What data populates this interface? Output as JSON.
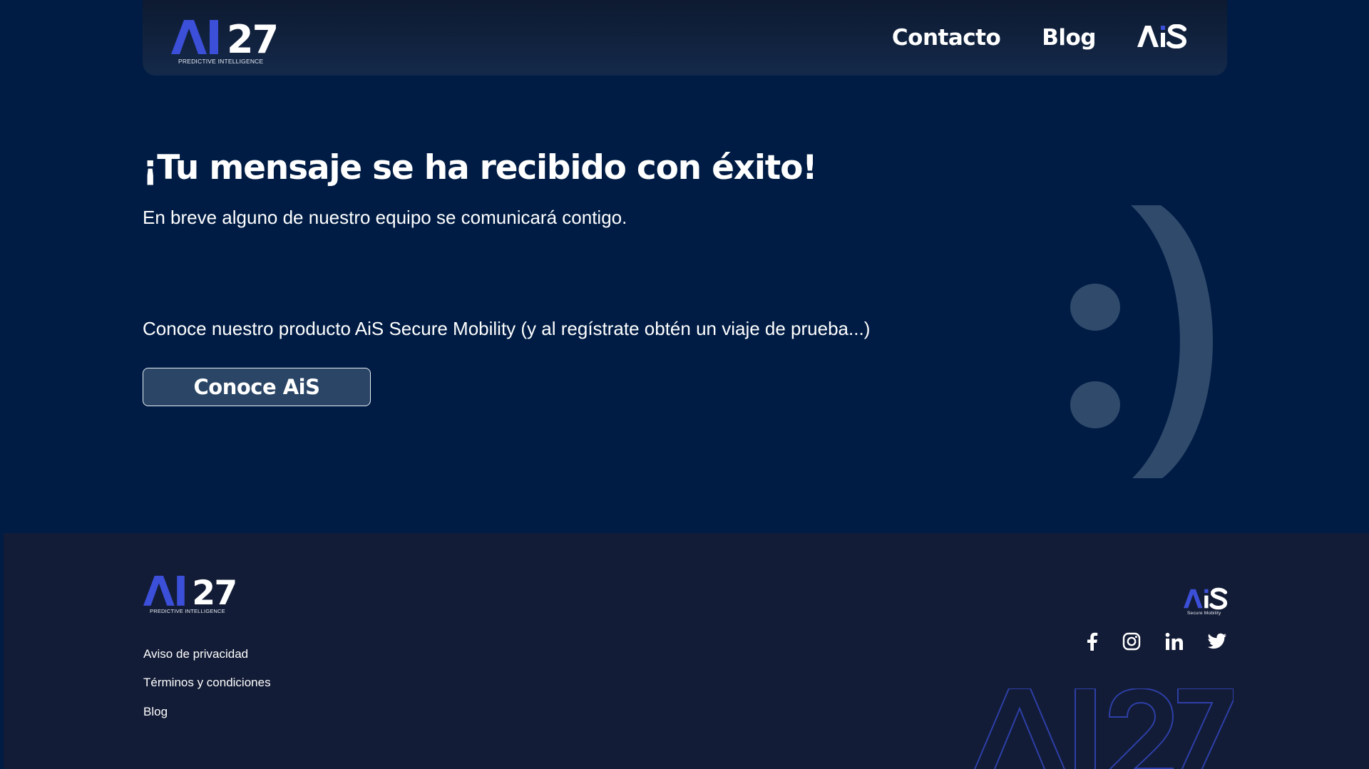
{
  "header": {
    "logo_text": "AI27",
    "logo_tagline": "PREDICTIVE INTELLIGENCE",
    "nav": [
      {
        "label": "Contacto"
      },
      {
        "label": "Blog"
      }
    ],
    "ais_logo_text": "AiS"
  },
  "main": {
    "title": "¡Tu mensaje se ha recibido con éxito!",
    "subtitle": "En breve alguno de nuestro equipo se comunicará contigo.",
    "promo": "Conoce nuestro producto AiS Secure Mobility (y al regístrate obtén un viaje de prueba...)",
    "cta_label": "Conoce AiS",
    "smiley_glyph": ":)"
  },
  "footer": {
    "logo_text": "AI27",
    "logo_tagline": "PREDICTIVE INTELLIGENCE",
    "ais_logo_text": "AiS",
    "ais_tagline": "Secure Mobility",
    "links": [
      {
        "label": "Aviso de privacidad"
      },
      {
        "label": "Términos y condiciones"
      },
      {
        "label": "Blog"
      }
    ],
    "social_icons": [
      "facebook-icon",
      "instagram-icon",
      "linkedin-icon",
      "twitter-icon"
    ],
    "watermark_text": "AI27"
  },
  "colors": {
    "page_bg": "#001c44",
    "footer_bg": "#131c36",
    "brand_blue": "#3b4fd8",
    "button_bg": "#2a4565",
    "smiley": "#2f4a6b"
  }
}
